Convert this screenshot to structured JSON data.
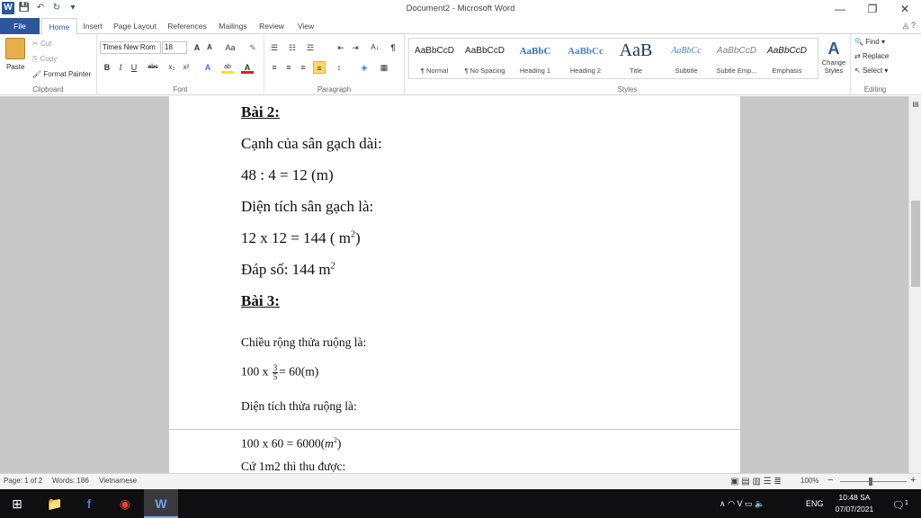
{
  "window": {
    "title": "Document2 - Microsoft Word",
    "qat": {
      "word": "W",
      "save": "💾",
      "undo": "↶",
      "redo": "↻",
      "customize": "▾"
    },
    "controls": {
      "minimize": "—",
      "restore": "❐",
      "close": "✕"
    }
  },
  "tabs": {
    "file": "File",
    "items": [
      "Home",
      "Insert",
      "Page Layout",
      "References",
      "Mailings",
      "Review",
      "View"
    ],
    "help": "◬ ?"
  },
  "ribbon": {
    "clipboard": {
      "label": "Clipboard",
      "paste": "Paste",
      "cut": "Cut",
      "copy": "Copy",
      "format_painter": "Format Painter"
    },
    "font": {
      "label": "Font",
      "name": "Times New Rom",
      "size": "18",
      "grow": "A",
      "shrink": "A",
      "case": "Aa",
      "clear": "✎",
      "bold": "B",
      "italic": "I",
      "underline": "U",
      "strike": "abc",
      "sub": "x₂",
      "sup": "x²",
      "effects": "A",
      "highlight": "ab",
      "color": "A"
    },
    "paragraph": {
      "label": "Paragraph",
      "bullets": "☰",
      "numbering": "☷",
      "multilevel": "☲",
      "dec_indent": "⇤",
      "inc_indent": "⇥",
      "sort": "A↓",
      "pilcrow": "¶",
      "align_left": "≡",
      "center": "≡",
      "align_right": "≡",
      "justify": "≡",
      "line_spacing": "↕",
      "shading": "◈",
      "borders": "▦"
    },
    "styles": {
      "label": "Styles",
      "items": [
        {
          "preview": "AaBbCcD",
          "name": "¶ Normal"
        },
        {
          "preview": "AaBbCcD",
          "name": "¶ No Spacing"
        },
        {
          "preview": "AaBbC",
          "name": "Heading 1"
        },
        {
          "preview": "AaBbCc",
          "name": "Heading 2"
        },
        {
          "preview": "AaB",
          "name": "Title"
        },
        {
          "preview": "AaBbCc",
          "name": "Subtitle"
        },
        {
          "preview": "AaBbCcD",
          "name": "Subtle Emp..."
        },
        {
          "preview": "AaBbCcD",
          "name": "Emphasis"
        }
      ],
      "change_styles": "Change Styles"
    },
    "editing": {
      "label": "Editing",
      "find": "Find",
      "replace": "Replace",
      "select": "Select"
    }
  },
  "document": {
    "lines": [
      "Bài 2:",
      "Cạnh của sân gạch dài:",
      "48 : 4 = 12 (m)",
      "Diện tích sân gạch là:",
      "12 x 12 = 144 ( m",
      "Đáp số: 144 m",
      "Bài 3:",
      "Chiều rộng thửa ruộng là:",
      "100 x",
      "= 60(m)",
      "Diện tích thửa ruộng là:",
      "100 x 60 = 6000(",
      "Cứ 1m2 thì thu được:"
    ],
    "sup2": "2",
    "close_paren": ")",
    "frac_num": "3",
    "frac_den": "5",
    "m_italic": "m"
  },
  "status": {
    "page": "Page: 1 of 2",
    "words": "Words: 186",
    "language": "Vietnamese",
    "zoom": "100%",
    "zoom_out": "−",
    "zoom_in": "+"
  },
  "taskbar": {
    "start": "⊞",
    "apps": [
      "📁",
      "f",
      "◉",
      "W"
    ],
    "tray_icons": "∧  ◠  V  ▭  🔈",
    "lang": "ENG",
    "time": "10:48 SA",
    "date": "07/07/2021",
    "notif": "1"
  }
}
